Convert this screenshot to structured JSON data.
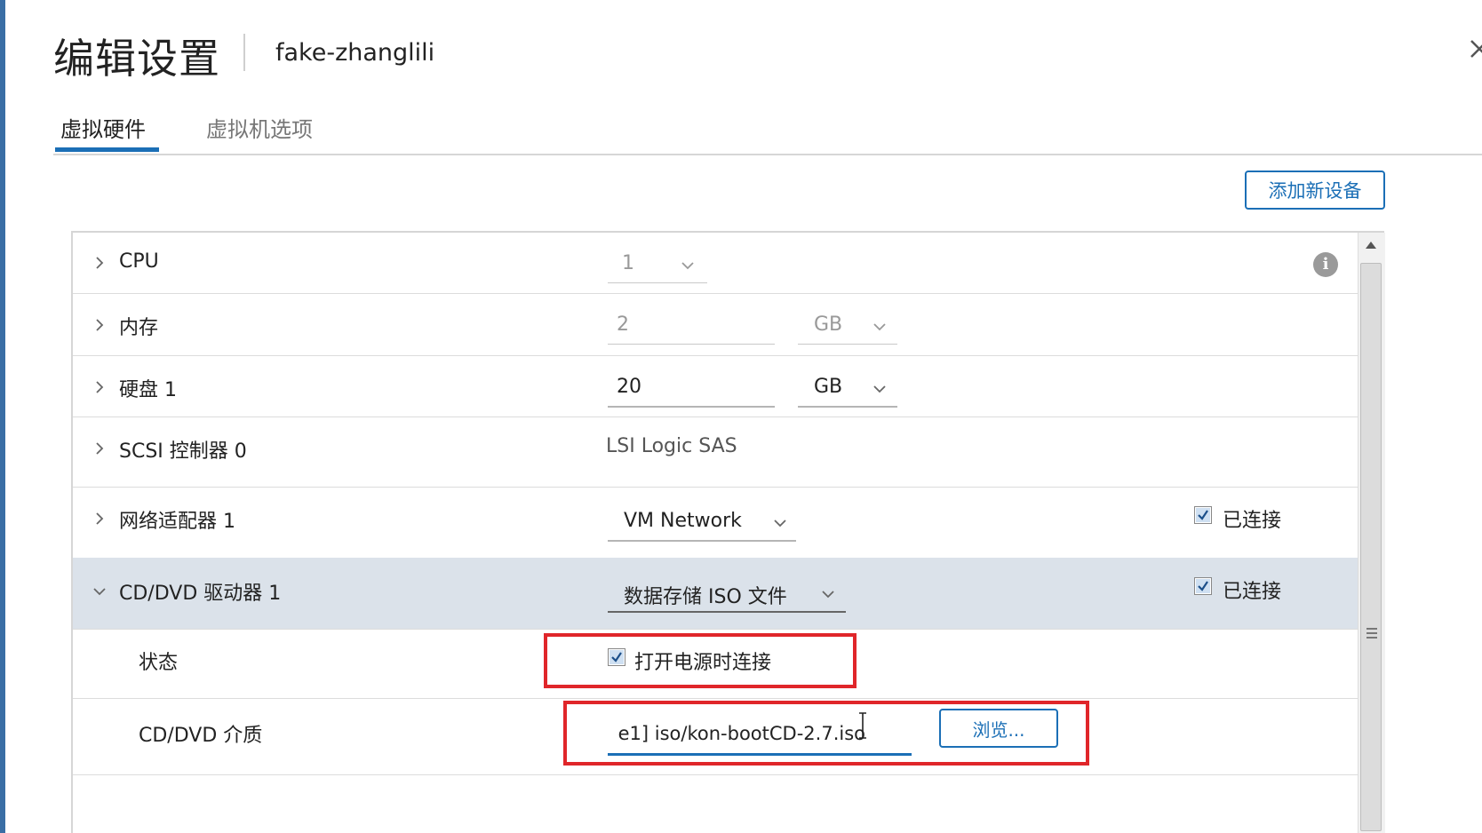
{
  "dialog": {
    "title": "编辑设置",
    "vm_name": "fake-zhanglili"
  },
  "tabs": [
    {
      "label": "虚拟硬件",
      "active": true
    },
    {
      "label": "虚拟机选项",
      "active": false
    }
  ],
  "toolbar": {
    "add_device_label": "添加新设备"
  },
  "hardware": {
    "cpu": {
      "label": "CPU",
      "value": "1"
    },
    "memory": {
      "label": "内存",
      "value": "2",
      "unit": "GB"
    },
    "disk": {
      "label": "硬盘 1",
      "value": "20",
      "unit": "GB"
    },
    "scsi": {
      "label": "SCSI 控制器 0",
      "value": "LSI Logic SAS"
    },
    "network": {
      "label": "网络适配器 1",
      "value": "VM Network",
      "connected_label": "已连接",
      "connected": true
    },
    "cddvd": {
      "label": "CD/DVD 驱动器 1",
      "value": "数据存储 ISO 文件",
      "connected_label": "已连接",
      "connected": true,
      "status": {
        "label": "状态",
        "power_on_connect_label": "打开电源时连接",
        "power_on_connect": true
      },
      "media": {
        "label": "CD/DVD 介质",
        "path": "e1] iso/kon-bootCD-2.7.iso",
        "browse_label": "浏览..."
      }
    }
  },
  "colors": {
    "accent": "#1b6fb6",
    "highlight": "#e0262a",
    "expanded_row": "#dbe2ea"
  }
}
